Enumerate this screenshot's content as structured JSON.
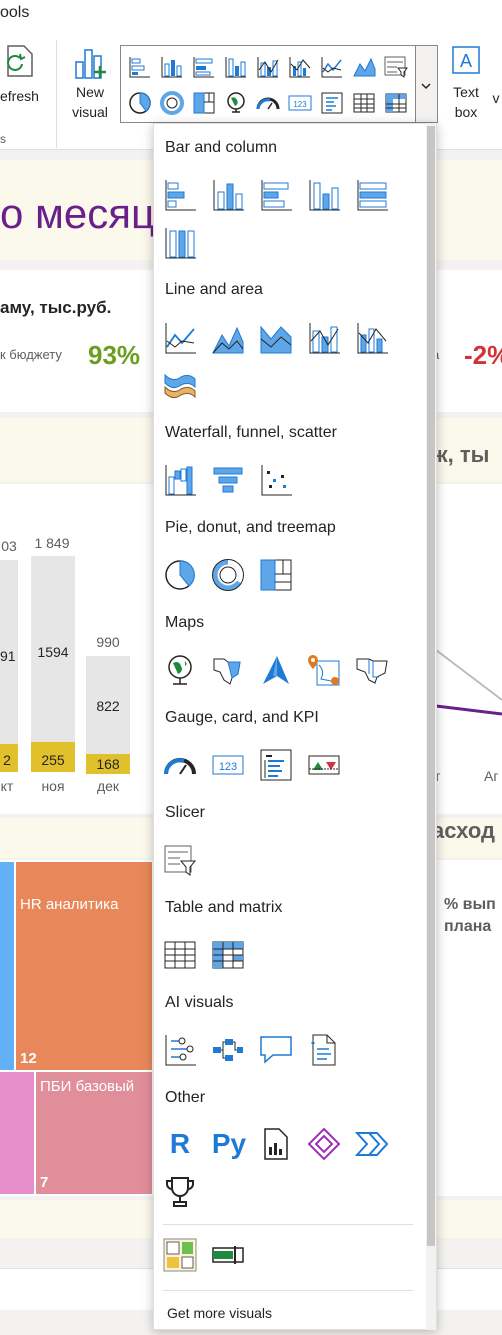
{
  "ribbon": {
    "tools_label": "ools",
    "refresh_label": "efresh",
    "new_visual_line1": "New",
    "new_visual_line2": "visual",
    "text_box_line1": "Text",
    "text_box_line2": "box",
    "cut_label": "v",
    "small_s": "s"
  },
  "report": {
    "title": "о месяц",
    "subtitle": "аму, тыс.руб.",
    "budget_label": "к бюджету",
    "kpi_left": "93%",
    "kpi_right_label": "а",
    "kpi_right": "-2%",
    "right_title": "ж, ты",
    "bars": [
      {
        "month": "кт",
        "total": "03",
        "grey": "91",
        "yellow": "2"
      },
      {
        "month": "ноя",
        "total": "1 849",
        "grey": "1594",
        "yellow": "255"
      },
      {
        "month": "дек",
        "total": "990",
        "grey": "822",
        "yellow": "168"
      }
    ],
    "right_axis_labels": [
      "т",
      "Аг"
    ],
    "expense_title": "асход",
    "expense_sub1": "% вып",
    "expense_sub2": "плана",
    "treemap": [
      {
        "label": "HR аналитика",
        "value": "12"
      },
      {
        "label": "ПБИ базовый",
        "value": "7"
      }
    ]
  },
  "panel": {
    "sections": [
      {
        "title": "Bar and column",
        "icons": [
          "stacked-bar-icon",
          "stacked-column-icon",
          "clustered-bar-icon",
          "clustered-column-icon",
          "100-stacked-bar-icon",
          "100-stacked-column-icon"
        ]
      },
      {
        "title": "Line and area",
        "icons": [
          "line-chart-icon",
          "area-chart-icon",
          "stacked-area-icon",
          "line-clustered-column-icon",
          "line-stacked-column-icon",
          "ribbon-chart-icon"
        ]
      },
      {
        "title": "Waterfall, funnel, scatter",
        "icons": [
          "waterfall-icon",
          "funnel-icon",
          "scatter-icon"
        ]
      },
      {
        "title": "Pie, donut, and treemap",
        "icons": [
          "pie-icon",
          "donut-icon",
          "treemap-icon"
        ]
      },
      {
        "title": "Maps",
        "icons": [
          "map-icon",
          "filled-map-icon",
          "azure-map-icon",
          "arcgis-map-icon",
          "shape-map-icon"
        ]
      },
      {
        "title": "Gauge, card, and KPI",
        "icons": [
          "gauge-icon",
          "card-icon",
          "multirow-card-icon",
          "kpi-icon"
        ]
      },
      {
        "title": "Slicer",
        "icons": [
          "slicer-icon"
        ]
      },
      {
        "title": "Table and matrix",
        "icons": [
          "table-icon",
          "matrix-icon"
        ]
      },
      {
        "title": "AI visuals",
        "icons": [
          "key-influencers-icon",
          "decomposition-tree-icon",
          "qna-icon",
          "smart-narrative-icon"
        ]
      },
      {
        "title": "Other",
        "icons": [
          "r-visual-icon",
          "python-visual-icon",
          "paginated-report-icon",
          "power-apps-icon",
          "power-automate-icon",
          "trophy-icon"
        ]
      }
    ],
    "custom_icons": [
      "custom-visual-kpi-icon",
      "custom-visual-bullet-icon"
    ],
    "get_more_label": "Get more visuals",
    "r_label": "R",
    "py_label": "Py",
    "card_label": "123"
  },
  "colors": {
    "accent_blue": "#1f7ad4",
    "title_purple": "#6b1f8a",
    "kpi_green": "#6b9e1f",
    "kpi_red": "#d13438",
    "bar_yellow": "#e0c12b",
    "treemap_orange": "#e8875a",
    "treemap_pink": "#e08e9a"
  }
}
